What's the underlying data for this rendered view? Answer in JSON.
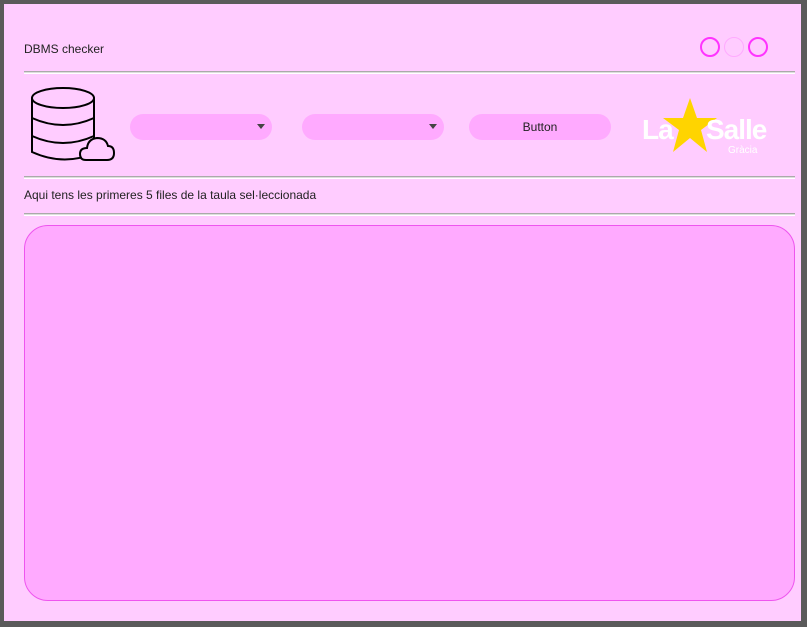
{
  "window": {
    "title": "DBMS checker",
    "controls": [
      "minimize",
      "maximize",
      "close"
    ]
  },
  "toolbar": {
    "icon": "database-cloud-icon",
    "combo1_value": "",
    "combo2_value": "",
    "button_label": "Button"
  },
  "logo": {
    "text_left": "La",
    "text_right": "Salle",
    "subtext": "Gràcia",
    "star_color": "#ffd400"
  },
  "caption": "Aqui tens les primeres 5 files de la taula sel·leccionada",
  "table": {
    "rows": []
  },
  "colors": {
    "background": "#ffccff",
    "accent": "#ffaaff",
    "control_border": "#ff33ff"
  }
}
